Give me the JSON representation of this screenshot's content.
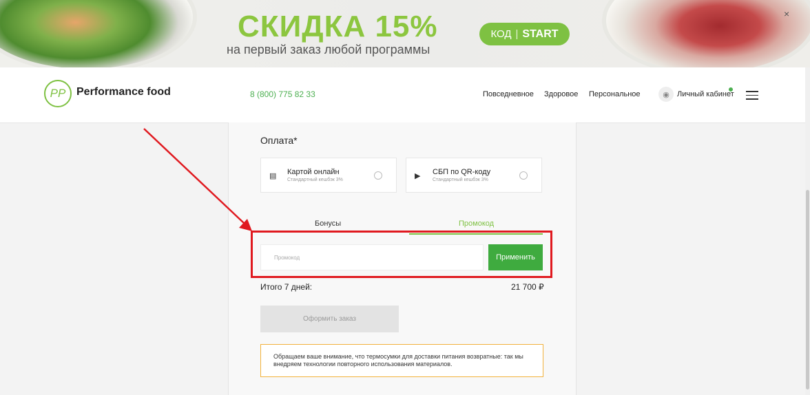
{
  "banner": {
    "title": "СКИДКА 15%",
    "subtitle": "на первый заказ любой программы",
    "code_label": "КОД",
    "code_value": "START",
    "close": "×"
  },
  "header": {
    "logo_text": "PP",
    "brand": "Performance food",
    "phone": "8 (800) 775 82 33",
    "nav": [
      "Повседневное",
      "Здоровое",
      "Персональное"
    ],
    "account": "Личный кабинет"
  },
  "payment": {
    "title": "Оплата*",
    "options": [
      {
        "icon": "card-icon",
        "label": "Картой онлайн",
        "note": "Стандартный кешбэк 3%"
      },
      {
        "icon": "sbp-icon",
        "label": "СБП по QR-коду",
        "note": "Стандартный кешбэк 3%"
      }
    ]
  },
  "discount": {
    "tabs": [
      "Бонусы",
      "Промокод"
    ],
    "active_tab": "Промокод",
    "promo_placeholder": "Промокод",
    "apply_label": "Применить"
  },
  "summary": {
    "total_label": "Итого 7 дней:",
    "total_value": "21 700 ₽",
    "order_button": "Оформить заказ"
  },
  "notice": {
    "text": "Обращаем ваше внимание, что термосумки для доставки питания возвратные: так мы внедряем технологии повторного использования материалов."
  },
  "colors": {
    "accent": "#7ec142",
    "button_green": "#3fab3f",
    "highlight_red": "#e0191f",
    "notice_border": "#f2b13a"
  }
}
